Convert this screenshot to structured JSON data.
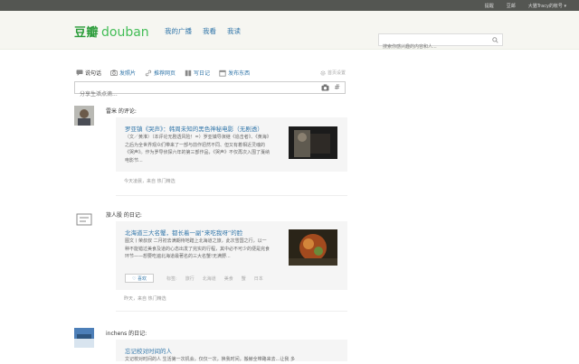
{
  "topbar": {
    "links": [
      "提醒",
      "豆邮",
      "大猫Tracy的帐号 ▾"
    ]
  },
  "nav": {
    "logo_cn": "豆瓣",
    "logo_en": "douban",
    "links": [
      "我的广播",
      "我看",
      "我读"
    ],
    "search_placeholder": "搜索你感兴趣的内容和人..."
  },
  "toolbar": {
    "items": [
      {
        "label": "说句话",
        "icon": "speech-icon"
      },
      {
        "label": "发照片",
        "icon": "camera-icon"
      },
      {
        "label": "推荐网页",
        "icon": "link-icon"
      },
      {
        "label": "写日记",
        "icon": "book-icon"
      },
      {
        "label": "发布东西",
        "icon": "shop-icon"
      }
    ],
    "settings_label": "首页设置"
  },
  "status": {
    "placeholder": "分享生活点滴...",
    "hash": "#"
  },
  "feed": [
    {
      "actor": "雷米 的评论:",
      "title": "罗亚镇《哭声》：韩周未知的黑色神秘电影（无剧透）",
      "desc": "（文／黄淮）（本评论无剧透风险！=）罗亚镇导演继《追击者》、《黄海》之后为全世界观众们带来了一部与前作迥然不同、但又有着相近灵魂的《哭声》。作为罗导侦探六年的第三部作品，《哭声》不仅再次入围了戛纳电影节...",
      "meta": "今天凌晨，来自 热门精选"
    },
    {
      "actor": "旅人股 的日记:",
      "title": "北海道三大名蟹，都长着一副“来吃我呀”的脸",
      "desc": "图文丨荣叔叔 二月初去满期待地踏上北海道之旅，此次雪国之行，以一种不能错过美食及道的心态出发了完实的行程，其中必不可少的便是完食环节——想要吃遍北海道最著名的三大名蟹!无满野...",
      "like": "♡ 喜欢",
      "tags": [
        "标签:",
        "旅行",
        "北海道",
        "美食",
        "蟹",
        "日本"
      ],
      "meta": "昨天，来自 热门精选"
    },
    {
      "actor": "inchens 的日记:",
      "title": "忘记校对时间的人",
      "desc": "文记校对时间的人 生活第一次机会，仅仅一次，换我时间，搬赫全带路来去...让我 多"
    }
  ]
}
